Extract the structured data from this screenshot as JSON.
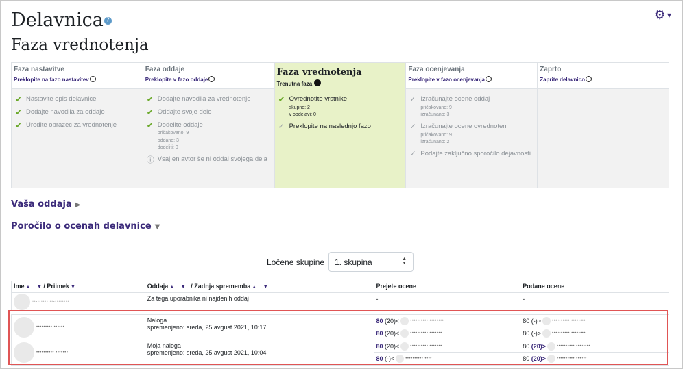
{
  "header": {
    "title": "Delavnica",
    "help_icon": "question-icon",
    "subtitle": "Faza vrednotenja",
    "settings_icon": "gear-icon"
  },
  "phases": [
    {
      "name": "Faza nastavitve",
      "link": "Preklopite na fazo nastavitev",
      "tasks": [
        {
          "label": "Nastavite opis delavnice",
          "icon": "check-icon"
        },
        {
          "label": "Dodajte navodila za oddajo",
          "icon": "check-icon"
        },
        {
          "label": "Uredite obrazec za vrednotenje",
          "icon": "check-icon"
        }
      ]
    },
    {
      "name": "Faza oddaje",
      "link": "Preklopite v fazo oddaje",
      "tasks": [
        {
          "label": "Dodajte navodila za vrednotenje",
          "icon": "check-icon"
        },
        {
          "label": "Oddajte svoje delo",
          "icon": "check-icon"
        },
        {
          "label": "Dodelite oddaje",
          "icon": "check-icon",
          "details": [
            "pričakovano: 9",
            "oddano: 3",
            "dodeliti: 0"
          ]
        },
        {
          "label": "Vsaj en avtor še ni oddal svojega dela",
          "icon": "info-icon"
        }
      ]
    },
    {
      "name": "Faza vrednotenja",
      "link": "Trenutna faza",
      "active": true,
      "tasks": [
        {
          "label": "Ovrednotite vrstnike",
          "icon": "check-icon",
          "details": [
            "skupno: 2",
            "v obdelavi: 0"
          ]
        },
        {
          "label": "Preklopite na naslednjo fazo",
          "icon": "check-grey-icon"
        }
      ]
    },
    {
      "name": "Faza ocenjevanja",
      "link": "Preklopite v fazo ocenjevanja",
      "tasks": [
        {
          "label": "Izračunajte ocene oddaj",
          "icon": "check-grey-icon",
          "details": [
            "pričakovano: 9",
            "izračunano: 3"
          ]
        },
        {
          "label": "Izračunajte ocene ovrednotenj",
          "icon": "check-grey-icon",
          "details": [
            "pričakovano: 9",
            "izračunano: 2"
          ]
        },
        {
          "label": "Podajte zaključno sporočilo dejavnosti",
          "icon": "check-grey-icon"
        }
      ]
    },
    {
      "name": "Zaprto",
      "link": "Zaprite delavnico",
      "tasks": []
    }
  ],
  "sections": {
    "your_submission": "Vaša oddaja",
    "grades_report": "Poročilo o ocenah delavnice"
  },
  "groups": {
    "label": "Ločene skupine",
    "selected": "1. skupina"
  },
  "table": {
    "headers": {
      "first_name": "Ime",
      "last_name": "/ Priimek",
      "submission": "Oddaja",
      "last_modified": "/ Zadnja sprememba",
      "received": "Prejete ocene",
      "given": "Podane ocene"
    },
    "rows": [
      {
        "user": "••-•••••• ••-••••••••",
        "submission_title": "Za tega uporabnika ni najdenih oddaj",
        "submission_date": "",
        "received": [
          {
            "prefix": "-",
            "score": "",
            "user": ""
          }
        ],
        "given": [
          {
            "prefix": "-",
            "score": "",
            "user": ""
          }
        ]
      },
      {
        "user": "••••••••• ••••••",
        "submission_title": "Naloga",
        "submission_date": "spremenjeno: sreda, 25 avgust 2021, 10:17",
        "received": [
          {
            "prefix": "80",
            "score": "(20)<",
            "user": "•••••••••• ••••••••"
          },
          {
            "prefix": "80",
            "score": "(20)<",
            "user": "•••••••••• •••••••"
          }
        ],
        "given": [
          {
            "prefix": "80",
            "score": "(-)>",
            "user": "•••••••••• ••••••••"
          },
          {
            "prefix": "80",
            "score": "(-)>",
            "user": "•••••••••• ••••••••"
          }
        ]
      },
      {
        "user": "•••••••••• •••••••",
        "submission_title": "Moja naloga",
        "submission_date": "spremenjeno: sreda, 25 avgust 2021, 10:04",
        "received": [
          {
            "prefix": "80",
            "score": "(20)<",
            "user": "•••••••••• •••••••"
          },
          {
            "prefix": "80",
            "score": "(-)<",
            "user": "•••••••••• ••••"
          }
        ],
        "given": [
          {
            "prefix": "80",
            "score": "(20)>",
            "user": "•••••••••• ••••••••"
          },
          {
            "prefix": "80",
            "score": "(20)>",
            "user": "•••••••••• ••••••"
          }
        ]
      }
    ]
  },
  "colors": {
    "accent": "#3b2a7a",
    "active_phase": "#e8f2c8",
    "check": "#6ba92b",
    "highlight": "#e05555"
  }
}
